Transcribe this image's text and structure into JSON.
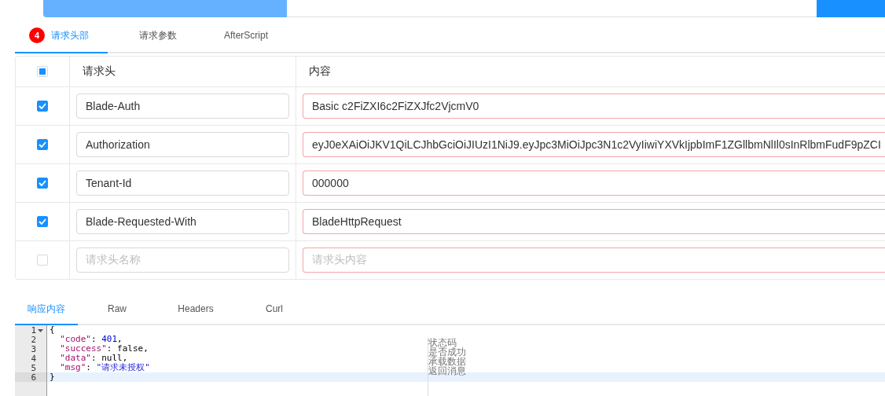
{
  "request_tabs": [
    {
      "label": "请求头部",
      "selected": true,
      "badge": "4"
    },
    {
      "label": "请求参数",
      "selected": false
    },
    {
      "label": "AfterScript",
      "selected": false
    }
  ],
  "headers_table": {
    "select_all": {
      "indeterminate": true
    },
    "columns": [
      "请求头",
      "内容"
    ],
    "rows": [
      {
        "checked": true,
        "name": "Blade-Auth",
        "value": "Basic c2FiZXI6c2FiZXJfc2VjcmV0"
      },
      {
        "checked": true,
        "name": "Authorization",
        "value": "eyJ0eXAiOiJKV1QiLCJhbGciOiJIUzI1NiJ9.eyJpc3MiOiJpc3N1c2VyIiwiYXVkIjpbImF1ZGllbmNlIl0sInRlbmFudF9pZCI"
      },
      {
        "checked": true,
        "name": "Tenant-Id",
        "value": "000000"
      },
      {
        "checked": true,
        "name": "Blade-Requested-With",
        "value": "BladeHttpRequest"
      },
      {
        "checked": false,
        "name_placeholder": "请求头名称",
        "value_placeholder": "请求头内容"
      }
    ]
  },
  "response_tabs": [
    {
      "label": "响应内容",
      "selected": true
    },
    {
      "label": "Raw",
      "selected": false
    },
    {
      "label": "Headers",
      "selected": false
    },
    {
      "label": "Curl",
      "selected": false
    }
  ],
  "editor": {
    "lines": [
      {
        "number": "1",
        "foldable": true,
        "active": false,
        "tokens": [
          {
            "kind": "punct",
            "text": "{"
          }
        ]
      },
      {
        "number": "2",
        "foldable": false,
        "active": false,
        "tokens": [
          {
            "kind": "key",
            "text": "  \"code\""
          },
          {
            "kind": "punct",
            "text": ": "
          },
          {
            "kind": "number",
            "text": "401"
          },
          {
            "kind": "punct",
            "text": ","
          }
        ]
      },
      {
        "number": "3",
        "foldable": false,
        "active": false,
        "tokens": [
          {
            "kind": "key",
            "text": "  \"success\""
          },
          {
            "kind": "punct",
            "text": ": false,"
          }
        ]
      },
      {
        "number": "4",
        "foldable": false,
        "active": false,
        "tokens": [
          {
            "kind": "key",
            "text": "  \"data\""
          },
          {
            "kind": "punct",
            "text": ": null,"
          }
        ]
      },
      {
        "number": "5",
        "foldable": false,
        "active": false,
        "tokens": [
          {
            "kind": "key",
            "text": "  \"msg\""
          },
          {
            "kind": "punct",
            "text": ": "
          },
          {
            "kind": "string",
            "text": "\"请求未授权\""
          }
        ]
      },
      {
        "number": "6",
        "foldable": false,
        "active": true,
        "tokens": [
          {
            "kind": "punct",
            "text": "}"
          }
        ]
      }
    ],
    "comments": [
      "状态码",
      "是否成功",
      "承载数据",
      "返回消息"
    ]
  }
}
